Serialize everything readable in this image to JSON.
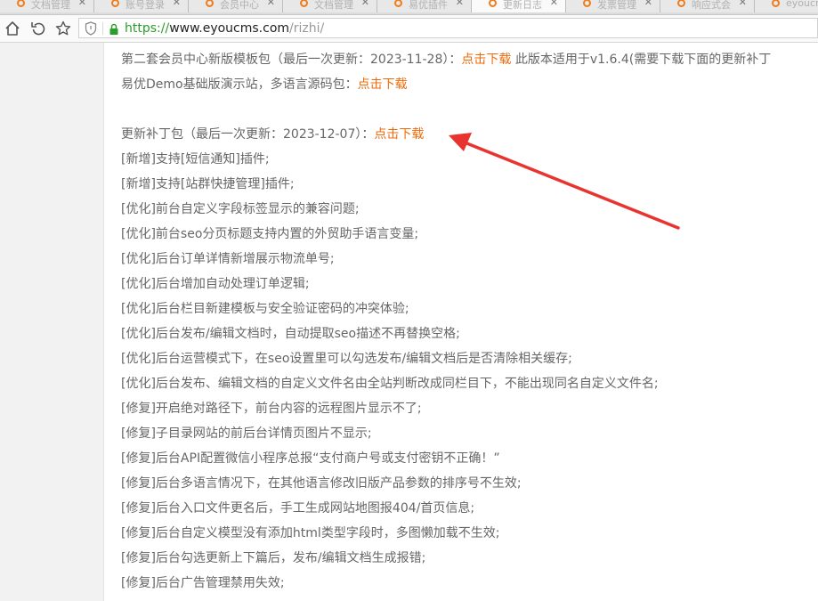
{
  "tabs": [
    {
      "label": "文档管理",
      "close": "✕"
    },
    {
      "label": "账号登录",
      "close": "✕"
    },
    {
      "label": "会员中心",
      "close": "✕"
    },
    {
      "label": "文档管理",
      "close": "✕"
    },
    {
      "label": "易优插件",
      "close": "✕"
    },
    {
      "label": "更新日志",
      "close": "✕",
      "active": true
    },
    {
      "label": "发票管理",
      "close": "✕"
    },
    {
      "label": "响应式会",
      "close": "✕"
    },
    {
      "label": "eyoucms",
      "close": ""
    }
  ],
  "url": {
    "scheme": "https://",
    "host": "www.eyoucms.com",
    "path": "/rizhi/"
  },
  "content": {
    "line1_prefix": "第二套会员中心新版模板包（最后一次更新：2023-11-28）：",
    "line1_link": "点击下载",
    "line1_suffix": " 此版本适用于v1.6.4(需要下载下面的更新补丁",
    "line2_prefix": "易优Demo基础版演示站，多语言源码包：",
    "line2_link": "点击下载",
    "patch_prefix": "更新补丁包（最后一次更新：2023-12-07）：",
    "patch_link": "点击下载",
    "changelog": [
      "[新增]支持[短信通知]插件;",
      "[新增]支持[站群快捷管理]插件;",
      "[优化]前台自定义字段标签显示的兼容问题;",
      "[优化]前台seo分页标题支持内置的外贸助手语言变量;",
      "[优化]后台订单详情新增展示物流单号;",
      "[优化]后台增加自动处理订单逻辑;",
      "[优化]后台栏目新建模板与安全验证密码的冲突体验;",
      "[优化]后台发布/编辑文档时，自动提取seo描述不再替换空格;",
      "[优化]后台运营模式下，在seo设置里可以勾选发布/编辑文档后是否清除相关缓存;",
      "[优化]后台发布、编辑文档的自定义文件名由全站判断改成同栏目下，不能出现同名自定义文件名;",
      "[修复]开启绝对路径下，前台内容的远程图片显示不了;",
      "[修复]子目录网站的前后台详情页图片不显示;",
      "[修复]后台API配置微信小程序总报“支付商户号或支付密钥不正确！”",
      "[修复]后台多语言情况下，在其他语言修改旧版产品参数的排序号不生效;",
      "[修复]后台入口文件更名后，手工生成网站地图报404/首页信息;",
      "[修复]后台自定义模型没有添加html类型字段时，多图懒加载不生效;",
      "[修复]后台勾选更新上下篇后，发布/编辑文档生成报错;",
      "[修复]后台广告管理禁用失效;"
    ]
  },
  "colors": {
    "link_orange": "#f06a0a",
    "annotation_arrow": "#e8332e",
    "secure_green": "#2a9d2a"
  }
}
